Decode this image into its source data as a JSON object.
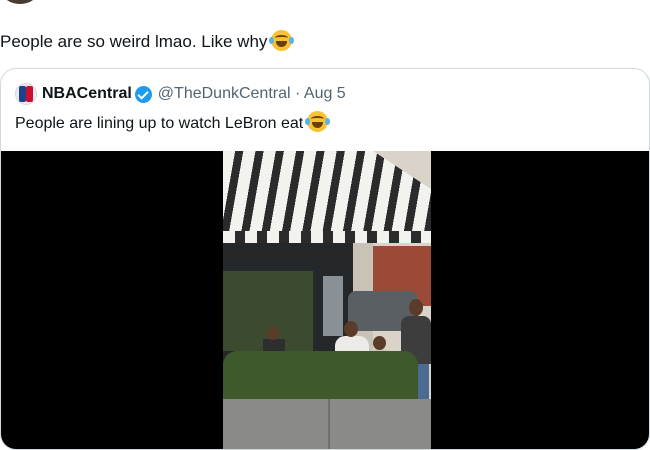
{
  "post": {
    "text": "People are so weird lmao. Like why",
    "emoji": "face-with-tears-of-joy"
  },
  "quoted_post": {
    "display_name": "NBACentral",
    "verified": true,
    "handle": "@TheDunkCentral",
    "separator": "·",
    "date": "Aug 5",
    "text": "People are lining up to watch LeBron eat",
    "emoji": "face-with-tears-of-joy",
    "media": "video"
  },
  "colors": {
    "text": "#0f1419",
    "secondary_text": "#536471",
    "border": "#cfd9de",
    "verified_badge": "#1d9bf0",
    "media_background": "#000000"
  }
}
